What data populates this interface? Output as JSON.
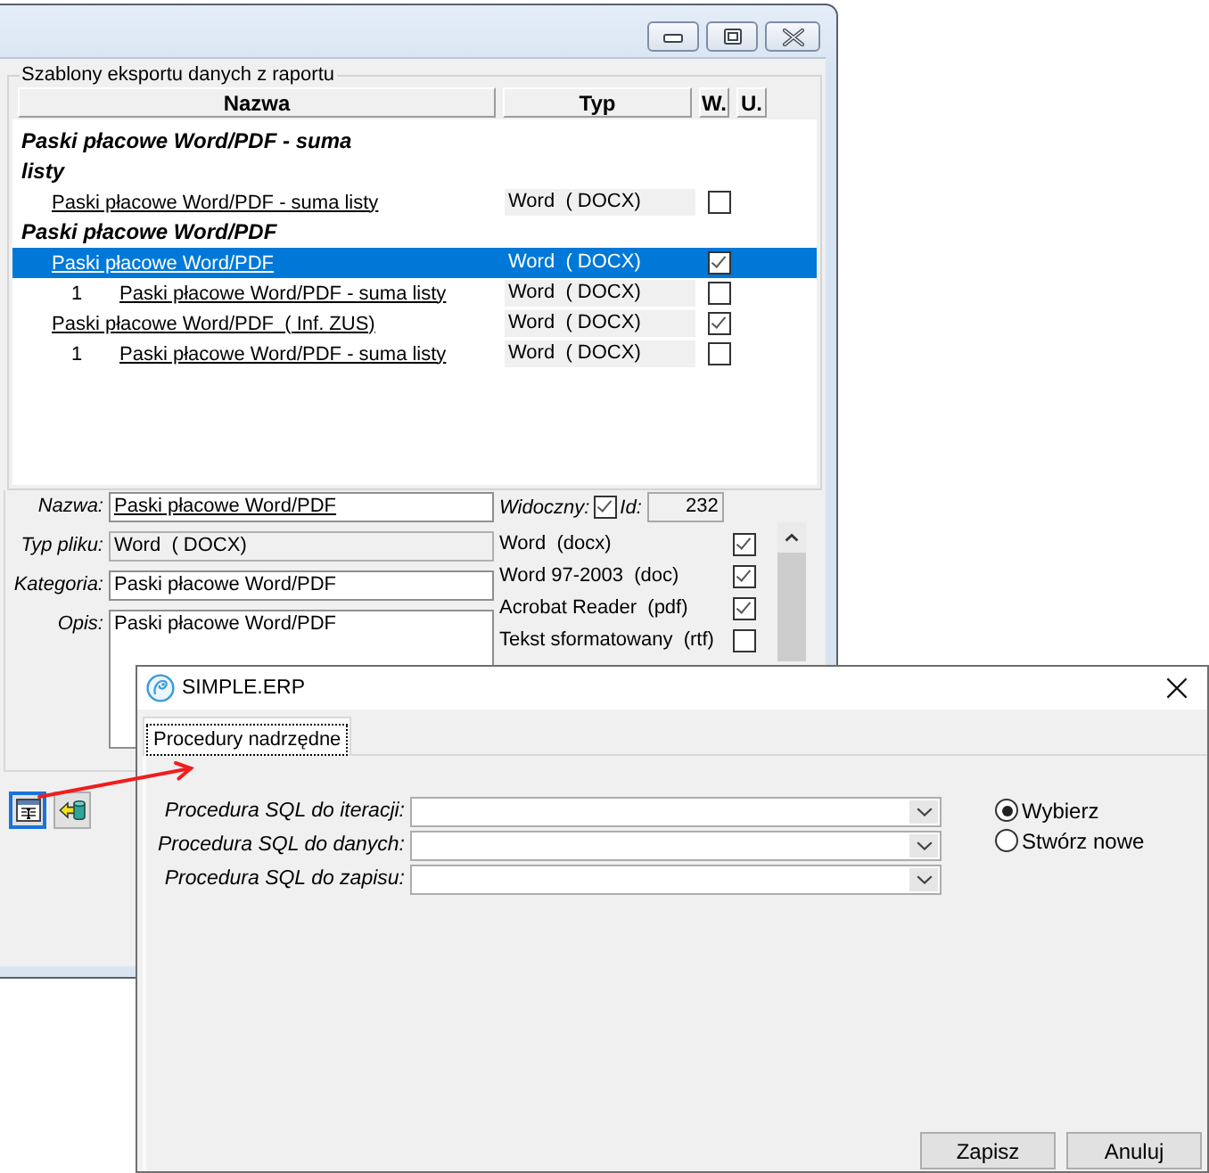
{
  "main_window": {
    "templates": {
      "title": "Szablony eksportu danych z raportu",
      "columns": [
        "Nazwa",
        "Typ",
        "W.",
        "U."
      ],
      "groups": [
        {
          "label": "Paski płacowe Word/PDF - suma listy",
          "items": [
            {
              "name": "Paski płacowe Word/PDF - suma listy",
              "type": "Word  ( DOCX)",
              "w_checked": false,
              "selected": false
            }
          ]
        },
        {
          "label": "Paski płacowe Word/PDF",
          "items": [
            {
              "name": "Paski płacowe Word/PDF",
              "type": "Word  ( DOCX)",
              "w_checked": true,
              "selected": true,
              "children": [
                {
                  "number": "1",
                  "name": "Paski płacowe Word/PDF - suma listy",
                  "type": "Word  ( DOCX)",
                  "w_checked": false,
                  "selected": false
                }
              ]
            },
            {
              "name": "Paski płacowe Word/PDF  ( Inf. ZUS)",
              "type": "Word  ( DOCX)",
              "w_checked": true,
              "selected": false,
              "children": [
                {
                  "number": "1",
                  "name": "Paski płacowe Word/PDF - suma listy",
                  "type": "Word  ( DOCX)",
                  "w_checked": false,
                  "selected": false
                }
              ]
            }
          ]
        }
      ]
    },
    "details": {
      "name": {
        "label": "Nazwa:",
        "value": "Paski płacowe Word/PDF"
      },
      "visible": {
        "label": "Widoczny:",
        "checked": true
      },
      "id": {
        "label": "Id:",
        "value": "232"
      },
      "file_type": {
        "label": "Typ pliku:",
        "value": "Word  ( DOCX)",
        "disabled": true
      },
      "category": {
        "label": "Kategoria:",
        "value": "Paski płacowe Word/PDF"
      },
      "description": {
        "label": "Opis:",
        "value": "Paski płacowe Word/PDF"
      }
    },
    "formats": [
      {
        "label": "Word  (docx)",
        "checked": true
      },
      {
        "label": "Word 97-2003  (doc)",
        "checked": true
      },
      {
        "label": "Acrobat Reader  (pdf)",
        "checked": true
      },
      {
        "label": "Tekst sformatowany  (rtf)",
        "checked": false
      }
    ],
    "toolbar": [
      {
        "kind": "form",
        "focused": true
      },
      {
        "kind": "import",
        "focused": false
      }
    ]
  },
  "dialog": {
    "title": "SIMPLE.ERP",
    "tabs": [
      {
        "label": "Procedury nadrzędne",
        "selected": true
      }
    ],
    "fields": [
      {
        "label": "Procedura SQL do iteracji:"
      },
      {
        "label": "Procedura SQL do danych:"
      },
      {
        "label": "Procedura SQL do zapisu:"
      }
    ],
    "options": [
      {
        "label": "Wybierz",
        "selected": true
      },
      {
        "label": "Stwórz nowe",
        "selected": false
      }
    ],
    "buttons": [
      "Zapisz",
      "Anuluj"
    ]
  }
}
